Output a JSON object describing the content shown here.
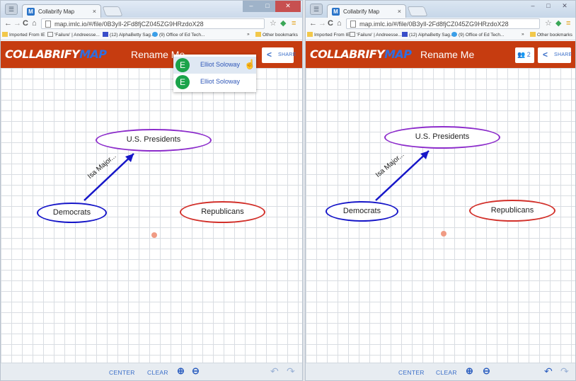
{
  "left": {
    "tab_title": "Collabrify Map",
    "url": "map.imlc.io/#/file/0B3yIl-2Fd8fjCZ045ZG9HRzdoX28",
    "bookmarks": [
      "Imported From IE",
      "'Failure' | Andreesse...",
      "(12) AlphaBetty Sag...",
      "(9) Office of Ed Tech...",
      "»",
      "Other bookmarks"
    ],
    "app": {
      "logo_main": "COLLABRIFY",
      "logo_accent": "MAP",
      "title": "Rename Me",
      "share": "SHARE"
    },
    "dropdown": [
      {
        "initial": "E",
        "name": "Elliot Soloway"
      },
      {
        "initial": "E",
        "name": "Elliot Soloway"
      }
    ],
    "map": {
      "nodes": {
        "presidents": "U.S. Presidents",
        "democrats": "Democrats",
        "republicans": "Republicans"
      },
      "link_label": "Isa Major..."
    },
    "footer": {
      "center": "CENTER",
      "clear": "CLEAR"
    }
  },
  "right": {
    "tab_title": "Collabrify Map",
    "url": "map.imlc.io/#/file/0B3yIl-2Fd8fjCZ045ZG9HRzdoX28",
    "bookmarks": [
      "Imported From IE",
      "'Failure' | Andreesse...",
      "(12) AlphaBetty Sag...",
      "(9) Office of Ed Tech...",
      "»",
      "Other bookmarks"
    ],
    "app": {
      "logo_main": "COLLABRIFY",
      "logo_accent": "MAP",
      "title": "Rename Me",
      "users_count": "2",
      "share": "SHARE"
    },
    "map": {
      "nodes": {
        "presidents": "U.S. Presidents",
        "democrats": "Democrats",
        "republicans": "Republicans"
      },
      "link_label": "Isa Major..."
    },
    "footer": {
      "center": "CENTER",
      "clear": "CLEAR"
    }
  },
  "colors": {
    "appbar": "#c63c10",
    "accent_blue": "#3b6fc9",
    "node_purple": "#8c2ccb",
    "node_blue": "#1616c8",
    "node_red": "#d2302a",
    "avatar_green": "#1aa34a"
  },
  "icons": [
    "back-arrow-icon",
    "forward-arrow-icon",
    "reload-icon",
    "home-icon",
    "star-icon",
    "extension-icon",
    "menu-icon",
    "share-icon",
    "users-icon",
    "zoom-in-icon",
    "zoom-out-icon",
    "undo-icon",
    "redo-icon",
    "hand-cursor-icon"
  ]
}
